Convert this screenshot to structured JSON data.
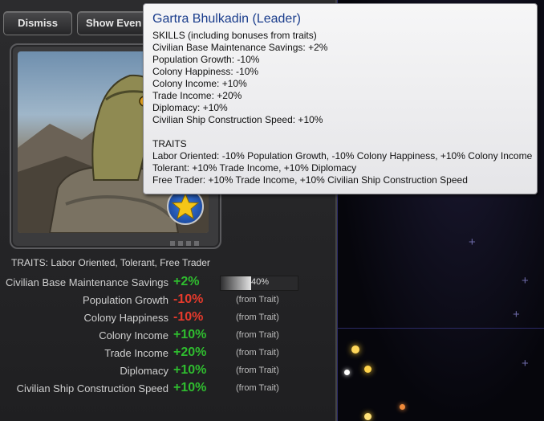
{
  "toolbar": {
    "dismiss_label": "Dismiss",
    "show_events_label": "Show Even"
  },
  "leader": {
    "traits_line": "TRAITS: Labor Oriented, Tolerant, Free Trader",
    "bar_percent_label": "40%",
    "bar_level": 0.4,
    "stats": [
      {
        "label": "Civilian Base Maintenance Savings",
        "value": "+2%",
        "note": ""
      },
      {
        "label": "Population Growth",
        "value": "-10%",
        "note": "(from Trait)"
      },
      {
        "label": "Colony Happiness",
        "value": "-10%",
        "note": "(from Trait)"
      },
      {
        "label": "Colony Income",
        "value": "+10%",
        "note": "(from Trait)"
      },
      {
        "label": "Trade Income",
        "value": "+20%",
        "note": "(from Trait)"
      },
      {
        "label": "Diplomacy",
        "value": "+10%",
        "note": "(from Trait)"
      },
      {
        "label": "Civilian Ship Construction Speed",
        "value": "+10%",
        "note": "(from Trait)"
      }
    ]
  },
  "tooltip": {
    "title": "Gartra Bhulkadin (Leader)",
    "skills_header": "SKILLS (including bonuses from traits)",
    "skills": [
      "Civilian Base Maintenance Savings: +2%",
      "Population Growth: -10%",
      "Colony Happiness: -10%",
      "Colony Income: +10%",
      "Trade Income: +20%",
      "Diplomacy: +10%",
      "Civilian Ship Construction Speed: +10%"
    ],
    "traits_header": "TRAITS",
    "traits": [
      "Labor Oriented: -10% Population Growth, -10% Colony Happiness, +10% Colony Income",
      "Tolerant: +10% Trade Income, +10% Diplomacy",
      "Free Trader: +10% Trade Income, +10% Civilian Ship Construction Speed"
    ]
  },
  "colors": {
    "positive": "#2fbd2f",
    "negative": "#e53a2c",
    "tooltip_title": "#1a3d8c",
    "grid": "#2b2a66"
  }
}
